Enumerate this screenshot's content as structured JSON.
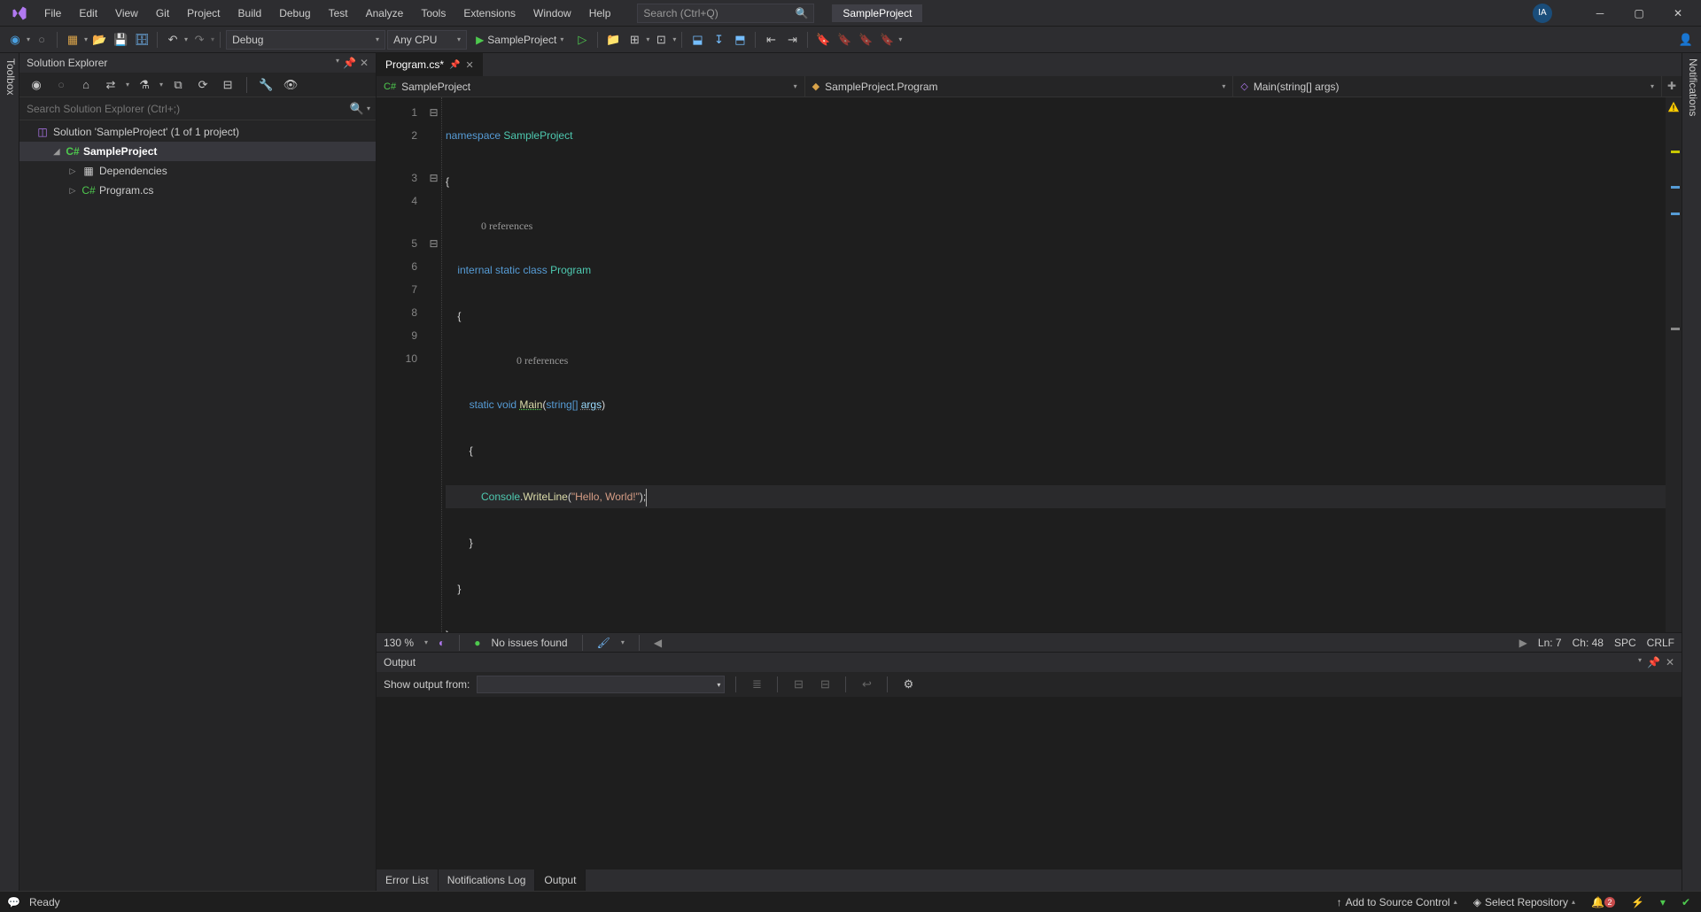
{
  "menubar": {
    "items": [
      "File",
      "Edit",
      "View",
      "Git",
      "Project",
      "Build",
      "Debug",
      "Test",
      "Analyze",
      "Tools",
      "Extensions",
      "Window",
      "Help"
    ],
    "search_placeholder": "Search (Ctrl+Q)",
    "project_title": "SampleProject",
    "avatar_initials": "IA"
  },
  "toolbar": {
    "config": "Debug",
    "platform": "Any CPU",
    "start_target": "SampleProject"
  },
  "toolbox_tab": "Toolbox",
  "notifications_tab": "Notifications",
  "solution_explorer": {
    "title": "Solution Explorer",
    "search_placeholder": "Search Solution Explorer (Ctrl+;)",
    "tree": {
      "solution": "Solution 'SampleProject' (1 of 1 project)",
      "project": "SampleProject",
      "nodes": [
        "Dependencies",
        "Program.cs"
      ]
    }
  },
  "editor": {
    "tab_label": "Program.cs*",
    "nav": {
      "scope1": "SampleProject",
      "scope2": "SampleProject.Program",
      "scope3": "Main(string[] args)"
    },
    "codelens_refs": "0 references",
    "zoom": "130 %",
    "issues": "No issues found",
    "cursor_ln": "Ln: 7",
    "cursor_ch": "Ch: 48",
    "spaces": "SPC",
    "eol": "CRLF",
    "code": {
      "l1_ns": "namespace",
      "l1_name": "SampleProject",
      "l2": "{",
      "l3_mods": "internal static class",
      "l3_name": "Program",
      "l4": "    {",
      "l5_mods": "static void",
      "l5_fn": "Main",
      "l5_sig_open": "(",
      "l5_type": "string[]",
      "l5_arg": "args",
      "l5_sig_close": ")",
      "l6": "        {",
      "l7_obj": "Console",
      "l7_dot": ".",
      "l7_fn": "WriteLine",
      "l7_open": "(",
      "l7_str": "\"Hello, World!\"",
      "l7_close": ");",
      "l8": "        }",
      "l9": "    }",
      "l10": "}"
    },
    "line_numbers": [
      "1",
      "2",
      "3",
      "4",
      "5",
      "6",
      "7",
      "8",
      "9",
      "10"
    ]
  },
  "output": {
    "title": "Output",
    "show_from_label": "Show output from:"
  },
  "bottom_tabs": [
    "Error List",
    "Notifications Log",
    "Output"
  ],
  "statusbar": {
    "ready": "Ready",
    "add_source_control": "Add to Source Control",
    "select_repo": "Select Repository",
    "notif_count": "2"
  }
}
